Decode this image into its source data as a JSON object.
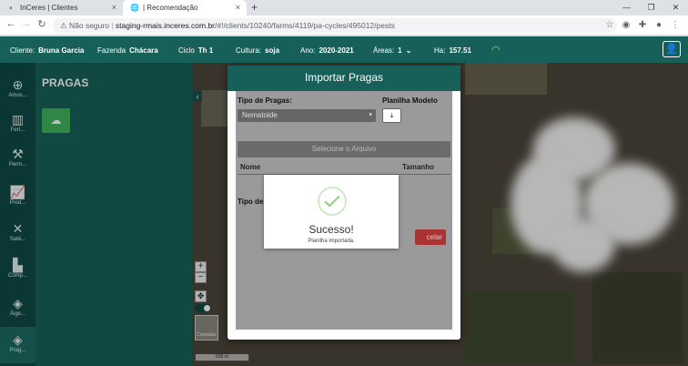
{
  "browser": {
    "tabs": [
      {
        "label": "InCeres | Clientes",
        "close": "×"
      },
      {
        "label": "| Recomendação",
        "close": "×"
      }
    ],
    "new_tab": "+",
    "url_security": "Não seguro",
    "url_host": "staging-rmais.inceres.com.br",
    "url_path": "/#!/clients/10240/farms/4119/pa-cycles/495012/pests"
  },
  "appbar": {
    "cliente_label": "Cliente:",
    "cliente_value": "Bruna Garcia",
    "fazenda_label": "Fazenda",
    "fazenda_value": "Chácara",
    "ciclo_label": "Ciclo",
    "ciclo_value": "Th 1",
    "cultura_label": "Cultura:",
    "cultura_value": "soja",
    "ano_label": "Ano:",
    "ano_value": "2020-2021",
    "areas_label": "Áreas:",
    "areas_value": "1",
    "ha_label": "Ha:",
    "ha_value": "157.51"
  },
  "sidebar": {
    "items": [
      {
        "label": "Amos...",
        "icon": "sample-icon"
      },
      {
        "label": "Fert...",
        "icon": "fertilizer-icon"
      },
      {
        "label": "Perm...",
        "icon": "permit-icon"
      },
      {
        "label": "Prod...",
        "icon": "chart-icon"
      },
      {
        "label": "Saté...",
        "icon": "satellite-icon"
      },
      {
        "label": "Comp...",
        "icon": "compare-icon"
      },
      {
        "label": "Álge...",
        "icon": "layers-icon"
      },
      {
        "label": "Prag...",
        "icon": "layers-icon"
      }
    ]
  },
  "panel": {
    "title": "PRAGAS"
  },
  "modal": {
    "title": "Importar Pragas",
    "tipo_label": "Tipo de Pragas:",
    "tipo_value": "Nematoide",
    "planilha_label": "Planilha Modelo",
    "file_button": "Selecione o Arquivo",
    "col_nome": "Nome",
    "col_tamanho": "Tamanho",
    "tipo_label2": "Tipo de",
    "cancel": "celar"
  },
  "success": {
    "title": "Sucesso!",
    "message": "Planilha importada."
  },
  "map": {
    "scale": "500 m",
    "maptype": "Camadas"
  }
}
